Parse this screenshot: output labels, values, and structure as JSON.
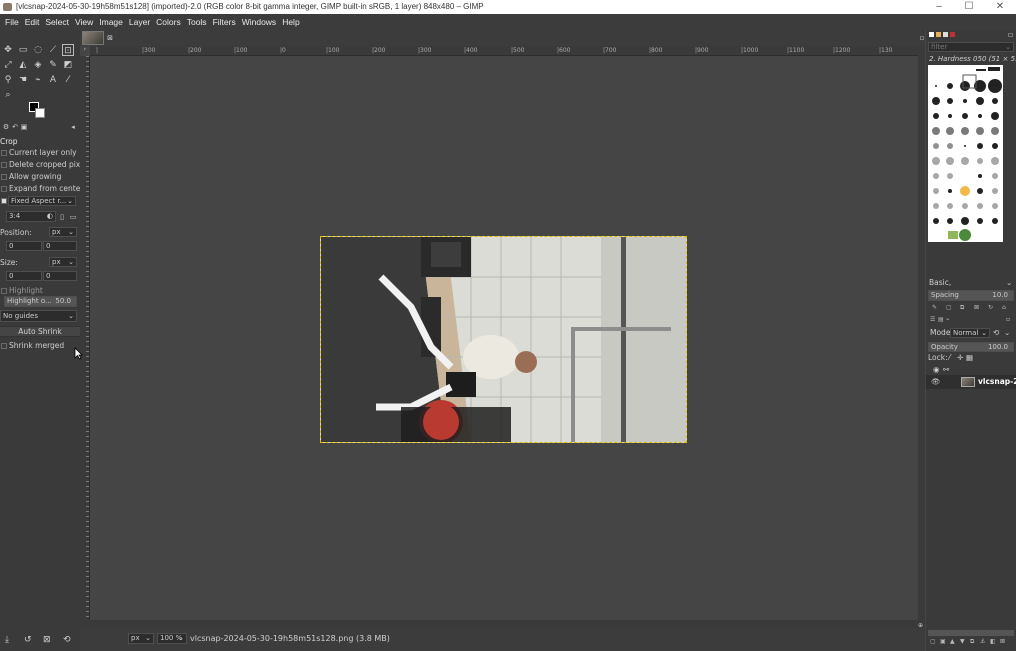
{
  "window": {
    "title": "[vlcsnap-2024-05-30-19h58m51s128] (imported)-2.0 (RGB color 8-bit gamma integer, GIMP built-in sRGB, 1 layer) 848x480 – GIMP",
    "controls": [
      "–",
      "☐",
      "✕"
    ]
  },
  "menubar": [
    "File",
    "Edit",
    "Select",
    "View",
    "Image",
    "Layer",
    "Colors",
    "Tools",
    "Filters",
    "Windows",
    "Help"
  ],
  "ruler": {
    "ticks": [
      "|",
      "|300",
      "|200",
      "|100",
      "|0",
      "|100",
      "|200",
      "|300",
      "|400",
      "|500",
      "|600",
      "|700",
      "|800",
      "|900",
      "|1000",
      "|1100",
      "|1200",
      "|130"
    ]
  },
  "tool_options": {
    "title": "Crop",
    "checkboxes": [
      "Current layer only",
      "Delete cropped pixels",
      "Allow growing",
      "Expand from center"
    ],
    "fixed_mode": "Fixed  Aspect r...",
    "ratio": "3:4",
    "position_label": "Position:",
    "size_label": "Size:",
    "unit": "px",
    "pos_x": "0",
    "pos_y": "0",
    "size_w": "0",
    "size_h": "0",
    "highlight_label": "Highlight",
    "highlight_opacity_label": "Highlight o...",
    "highlight_opacity_value": "50.0",
    "guides": "No guides",
    "auto_shrink": "Auto Shrink",
    "shrink_merged": "Shrink merged"
  },
  "status": {
    "unit": "px",
    "zoom": "100 %",
    "filename": "vlcsnap-2024-05-30-19h58m51s128.png (3.8 MB)"
  },
  "brushes": {
    "filter_placeholder": "filter",
    "selected": "2. Hardness 050 (51 × 51)",
    "tag": "Basic,",
    "spacing_label": "Spacing",
    "spacing_value": "10.0"
  },
  "layers": {
    "mode_label": "Mode",
    "mode_value": "Normal",
    "opacity_label": "Opacity",
    "opacity_value": "100.0",
    "lock_label": "Lock:",
    "layer_name": "vlcsnap-2"
  },
  "colors": {
    "bg": "#454545",
    "panel": "#3a3a3a",
    "selection": "#e0c000"
  }
}
